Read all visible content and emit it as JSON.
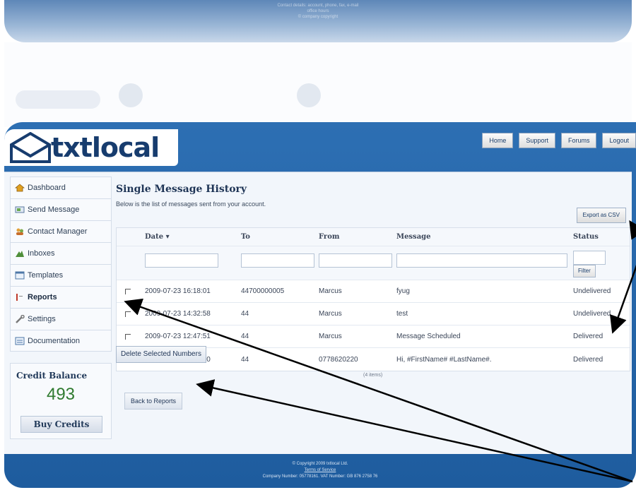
{
  "background": {
    "top_lines": [
      "Contact details: account, phone, fax, e-mail",
      "office hours",
      "© company copyright"
    ]
  },
  "header": {
    "logo": "txtlocal",
    "nav": [
      "Home",
      "Support",
      "Forums",
      "Logout"
    ]
  },
  "sidebar": {
    "items": [
      {
        "label": "Dashboard",
        "icon": "home-icon"
      },
      {
        "label": "Send Message",
        "icon": "send-message-icon"
      },
      {
        "label": "Contact Manager",
        "icon": "contacts-icon"
      },
      {
        "label": "Inboxes",
        "icon": "inbox-icon"
      },
      {
        "label": "Templates",
        "icon": "templates-icon"
      },
      {
        "label": "Reports",
        "icon": "reports-icon"
      },
      {
        "label": "Settings",
        "icon": "settings-icon"
      },
      {
        "label": "Documentation",
        "icon": "documentation-icon"
      }
    ],
    "active": "Reports"
  },
  "credit": {
    "title": "Credit Balance",
    "value": "493",
    "buy_label": "Buy Credits"
  },
  "main": {
    "title": "Single Message History",
    "description": "Below is the list of messages sent from your account.",
    "export_label": "Export as CSV",
    "filter_label": "Filter",
    "columns": [
      "Date ▾",
      "To",
      "From",
      "Message",
      "Status"
    ],
    "rows": [
      {
        "date": "2009-07-23 16:18:01",
        "to": "44700000005",
        "from": "Marcus",
        "message": "fyug",
        "status": "Undelivered"
      },
      {
        "date": "2009-07-23 14:32:58",
        "to": "44",
        "from": "Marcus",
        "message": "test",
        "status": "Undelivered"
      },
      {
        "date": "2009-07-23 12:47:51",
        "to": "44",
        "from": "Marcus",
        "message": "Message Scheduled",
        "status": "Delivered"
      },
      {
        "date": "2009-07-23 10:50:50",
        "to": "44",
        "from": "0778620220",
        "message": "Hi, #FirstName# #LastName#.",
        "status": "Delivered"
      }
    ],
    "delete_label": "Delete Selected Numbers",
    "items_count": "(4 items)",
    "back_label": "Back to Reports"
  },
  "footer": {
    "copyright": "© Copyright 2009 txtlocal Ltd.",
    "terms": "Terms of Service",
    "company": "Company Number: 05778161. VAT Number: GB 876 2758 76"
  },
  "colors": {
    "frame": "#2d6fb3",
    "logo": "#173c6e",
    "credit": "#2f7a2f"
  }
}
